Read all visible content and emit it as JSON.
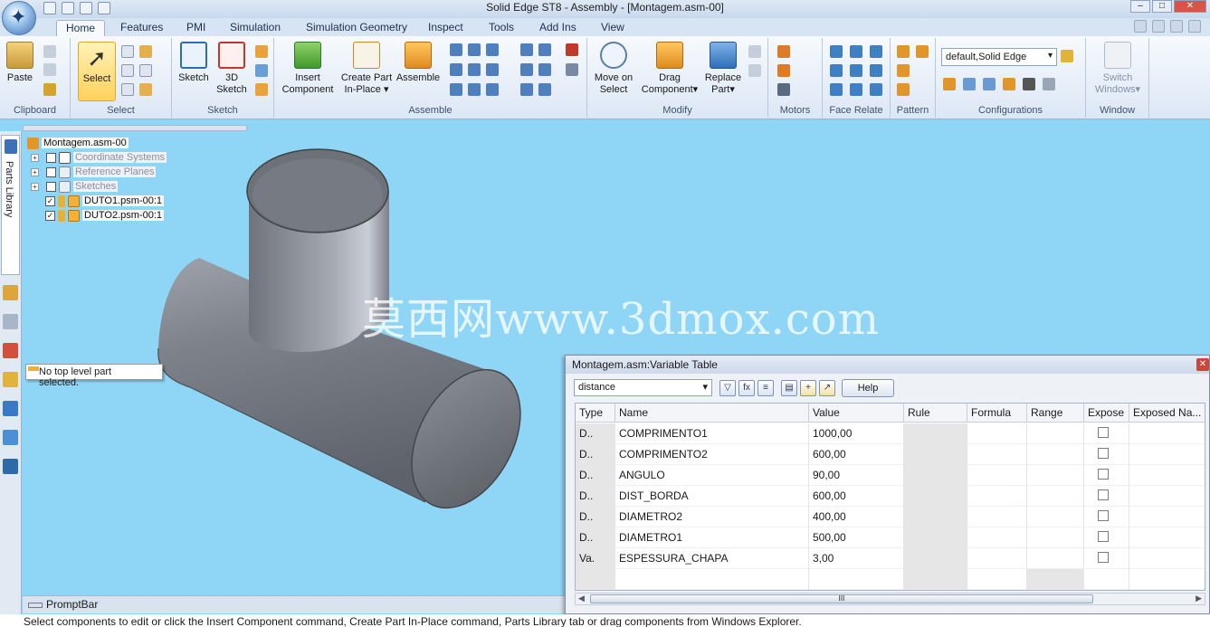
{
  "window": {
    "title": "Solid Edge ST8 - Assembly - [Montagem.asm-00]"
  },
  "tabs": [
    "Home",
    "Features",
    "PMI",
    "Simulation",
    "Simulation Geometry",
    "Inspect",
    "Tools",
    "Add Ins",
    "View"
  ],
  "ribbon": {
    "clipboard": {
      "paste": "Paste",
      "label": "Clipboard"
    },
    "select": {
      "select": "Select",
      "label": "Select"
    },
    "sketch": {
      "sketch": "Sketch",
      "sketch3d_1": "3D",
      "sketch3d_2": "Sketch",
      "label": "Sketch"
    },
    "assemble": {
      "insert_1": "Insert",
      "insert_2": "Component",
      "create_1": "Create Part",
      "create_2": "In-Place",
      "assemble": "Assemble",
      "label": "Assemble"
    },
    "modify": {
      "move_1": "Move on",
      "move_2": "Select",
      "drag_1": "Drag",
      "drag_2": "Component",
      "replace_1": "Replace",
      "replace_2": "Part",
      "label": "Modify"
    },
    "motors": {
      "label": "Motors"
    },
    "face_relate": {
      "label": "Face Relate"
    },
    "pattern": {
      "label": "Pattern"
    },
    "configurations": {
      "value": "default,Solid Edge",
      "label": "Configurations"
    },
    "window": {
      "switch_1": "Switch",
      "switch_2": "Windows",
      "label": "Window"
    }
  },
  "sidebar": {
    "parts_library": "Parts Library"
  },
  "tree": {
    "root": "Montagem.asm-00",
    "items": [
      {
        "label": "Coordinate Systems",
        "checked": false
      },
      {
        "label": "Reference Planes",
        "checked": false
      },
      {
        "label": "Sketches",
        "checked": false
      },
      {
        "label": "DUTO1.psm-00:1",
        "checked": true
      },
      {
        "label": "DUTO2.psm-00:1",
        "checked": true
      }
    ]
  },
  "tooltip": "No top level part selected.",
  "watermark": "莫西网www.3dmox.com",
  "promptbar": {
    "label": "PromptBar"
  },
  "status": "Select components to edit or click the Insert Component command, Create Part In-Place command, Parts Library tab or drag components from Windows Explorer.",
  "variable_table": {
    "title": "Montagem.asm:Variable Table",
    "filter": "distance",
    "help": "Help",
    "columns": [
      "Type",
      "Name",
      "Value",
      "Rule",
      "Formula",
      "Range",
      "Expose",
      "Exposed Na..."
    ],
    "rows": [
      {
        "type": "D..",
        "name": "COMPRIMENTO1",
        "value": "1000,00"
      },
      {
        "type": "D..",
        "name": "COMPRIMENTO2",
        "value": "600,00"
      },
      {
        "type": "D..",
        "name": "ANGULO",
        "value": "90,00"
      },
      {
        "type": "D..",
        "name": "DIST_BORDA",
        "value": "600,00"
      },
      {
        "type": "D..",
        "name": "DIAMETRO2",
        "value": "400,00"
      },
      {
        "type": "D..",
        "name": "DIAMETRO1",
        "value": "500,00"
      },
      {
        "type": "Va.",
        "name": "ESPESSURA_CHAPA",
        "value": "3,00"
      }
    ]
  }
}
